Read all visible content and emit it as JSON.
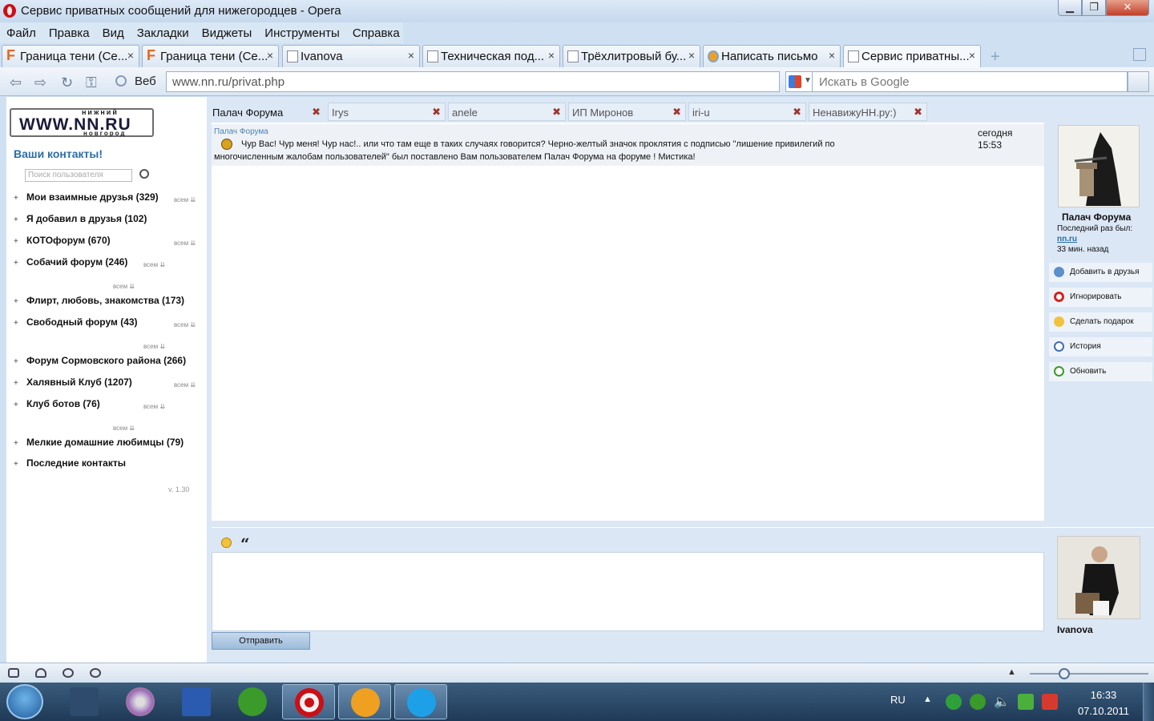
{
  "window": {
    "title": "Сервис приватных сообщений для нижегородцев - Opera"
  },
  "menu": [
    "Файл",
    "Правка",
    "Вид",
    "Закладки",
    "Виджеты",
    "Инструменты",
    "Справка"
  ],
  "tabs": [
    {
      "label": "Граница тени (Се...",
      "icon": "forum-f-icon"
    },
    {
      "label": "Граница тени (Се...",
      "icon": "forum-f-icon"
    },
    {
      "label": "Ivanova",
      "icon": "page-icon"
    },
    {
      "label": "Техническая под...",
      "icon": "page-icon"
    },
    {
      "label": "Трёхлитровый бу...",
      "icon": "page-icon"
    },
    {
      "label": "Написать письмо",
      "icon": "mail-icon"
    },
    {
      "label": "Сервис приватны...",
      "icon": "page-icon",
      "active": true
    }
  ],
  "nav": {
    "web_label": "Веб",
    "url": "www.nn.ru/privat.php",
    "search_placeholder": "Искать в Google"
  },
  "sidebar": {
    "logo_top": "нижний",
    "logo_main": "WWW.NN.RU",
    "logo_bottom": "новгород",
    "contacts_title": "Ваши контакты!",
    "search_placeholder": "Поиск пользователя",
    "vsem_label": "всем",
    "groups": [
      "Мои взаимные друзья (329)",
      "Я добавил в друзья (102)",
      "КОТОфорум (670)",
      "Собачий форум (246)",
      "Флирт, любовь, знакомства (173)",
      "Свободный форум (43)",
      "Форум Сормовского района (266)",
      "Халявный Клуб (1207)",
      "Клуб ботов (76)",
      "Мелкие домашние любимцы (79)",
      "Последние контакты"
    ],
    "version": "v. 1.30"
  },
  "contact_tabs": [
    "Палач Форума",
    "Irys",
    "anele",
    "ИП Миронов",
    "iri-u",
    "НенавижуНН.ру:)"
  ],
  "message": {
    "author": "Палач Форума",
    "line1": "Чур Вас! Чур меня! Чур нас!.. или что там еще в таких случаях говорится? Черно-желтый значок проклятия с подписью \"лишение привилегий по",
    "line2": "многочисленным жалобам пользователей\" был поставлено Вам пользователем Палач Форума на форуме ! Мистика!",
    "date": "сегодня",
    "time": "15:53"
  },
  "profile": {
    "name": "Палач Форума",
    "last_seen_label": "Последний раз был:",
    "site": "nn.ru",
    "ago": "33 мин. назад",
    "actions": [
      "Добавить в друзья",
      "Игнорировать",
      "Сделать подарок",
      "История",
      "Обновить"
    ]
  },
  "compose": {
    "send_label": "Отправить",
    "me_name": "Ivanova"
  },
  "taskbar": {
    "lang": "RU",
    "time": "16:33",
    "date": "07.10.2011",
    "apps": [
      "kmplayer",
      "dvd",
      "word",
      "utorrent",
      "opera",
      "mail-agent",
      "skype"
    ]
  },
  "colors": {
    "accent": "#2a6ea8",
    "page_bg": "#dbe7f5",
    "opera_red": "#cc0f16"
  }
}
